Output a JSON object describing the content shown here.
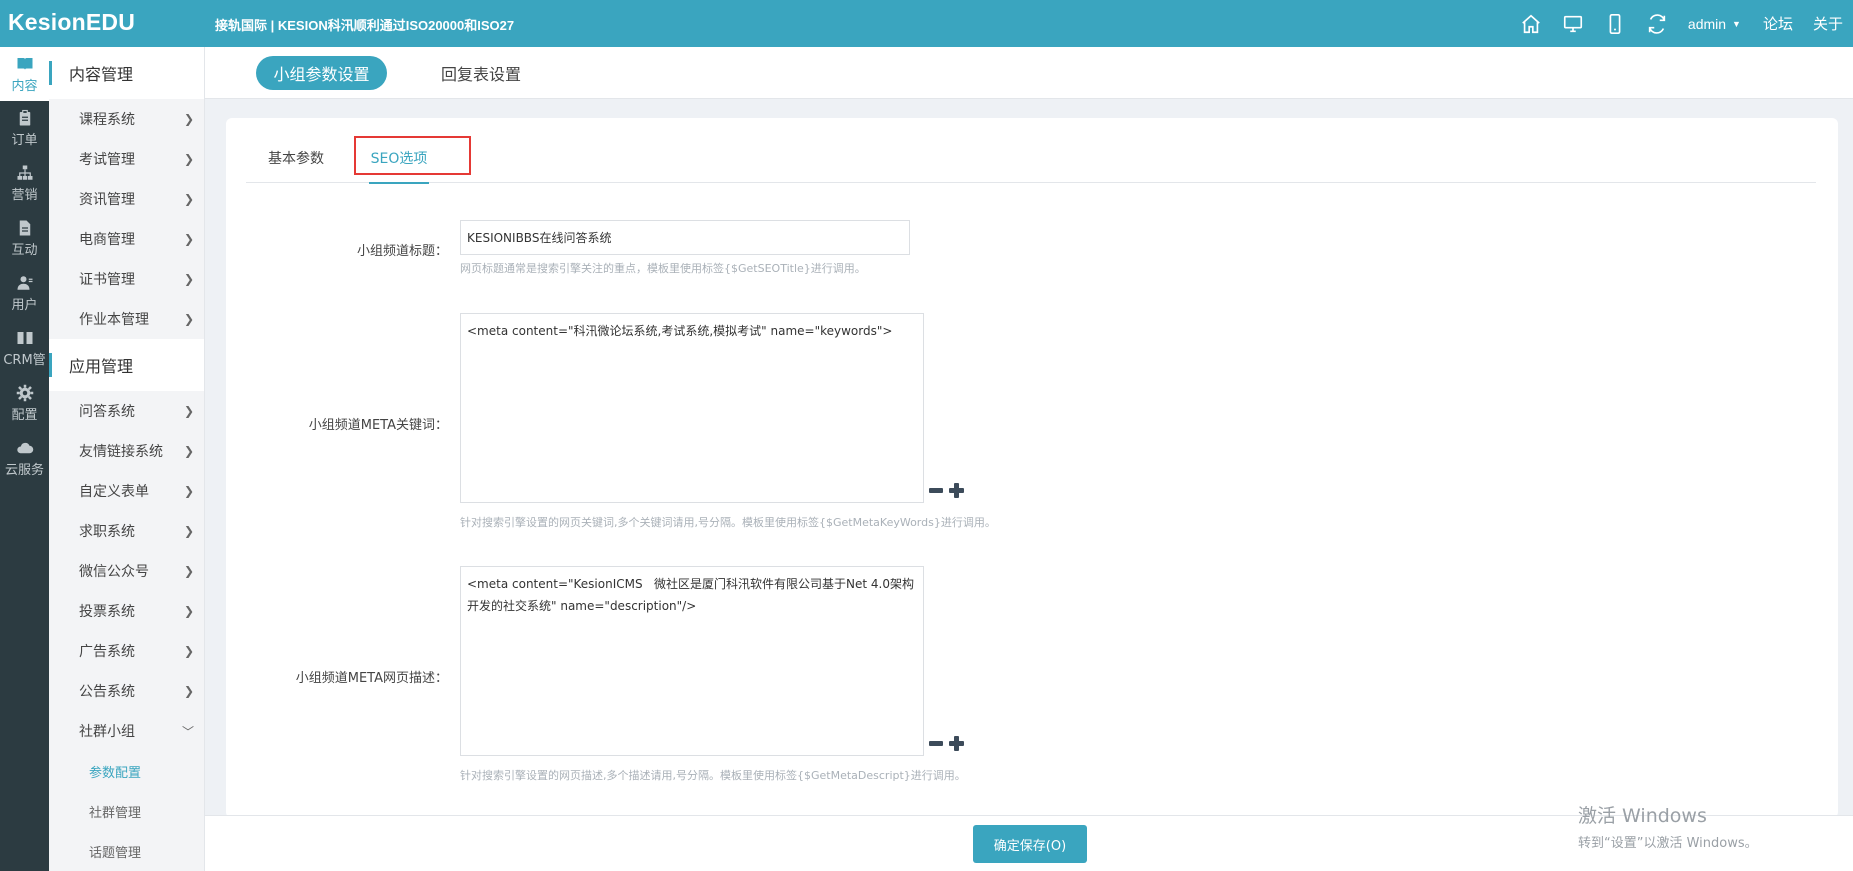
{
  "header": {
    "brand": "KesionEDU",
    "marquee": "接轨国际 | KESION科汛顺利通过ISO20000和ISO27",
    "admin": "admin",
    "links": [
      "论坛",
      "关于"
    ],
    "icons": [
      "home-icon",
      "desktop-icon",
      "mobile-icon",
      "refresh-icon"
    ]
  },
  "rail": {
    "items": [
      {
        "label": "内容",
        "icon": "book-icon",
        "active": true
      },
      {
        "label": "订单",
        "icon": "clipboard-icon"
      },
      {
        "label": "营销",
        "icon": "sitemap-icon"
      },
      {
        "label": "互动",
        "icon": "document-icon"
      },
      {
        "label": "用户",
        "icon": "user-icon"
      },
      {
        "label": "CRM管",
        "icon": "book-open-icon"
      },
      {
        "label": "配置",
        "icon": "gear-icon"
      },
      {
        "label": "云服务",
        "icon": "cloud-icon"
      }
    ]
  },
  "sidebar": {
    "group1": "内容管理",
    "group1_items": [
      "课程系统",
      "考试管理",
      "资讯管理",
      "电商管理",
      "证书管理",
      "作业本管理"
    ],
    "group2": "应用管理",
    "group2_items": [
      "问答系统",
      "友情链接系统",
      "自定义表单",
      "求职系统",
      "微信公众号",
      "投票系统",
      "广告系统",
      "公告系统"
    ],
    "expanded": "社群小组",
    "sub_items": [
      "参数配置",
      "社群管理",
      "话题管理"
    ]
  },
  "tabs": {
    "active": "小组参数设置",
    "other": "回复表设置"
  },
  "inner_tabs": {
    "basic": "基本参数",
    "seo": "SEO选项"
  },
  "form": {
    "title_label": "小组频道标题：",
    "title_value": "KESIONIBBS在线问答系统",
    "title_hint": "网页标题通常是搜索引擎关注的重点，模板里使用标签{$GetSEOTitle}进行调用。",
    "keywords_label": "小组频道META关键词：",
    "keywords_value": "<meta content=\"科汛微论坛系统,考试系统,模拟考试\" name=\"keywords\">",
    "keywords_hint": "针对搜索引擎设置的网页关键词,多个关键词请用,号分隔。模板里使用标签{$GetMetaKeyWords}进行调用。",
    "desc_label": "小组频道META网页描述：",
    "desc_value": "<meta content=\"KesionICMS   微社区是厦门科汛软件有限公司基于Net 4.0架构开发的社交系统\" name=\"description\"/>",
    "desc_hint": "针对搜索引擎设置的网页描述,多个描述请用,号分隔。模板里使用标签{$GetMetaDescript}进行调用。"
  },
  "save_label": "确定保存(O)",
  "watermark": {
    "line1": "激活 Windows",
    "line2": "转到“设置”以激活 Windows。"
  },
  "colors": {
    "primary": "#3aa5bf",
    "rail_bg": "#2c3b41",
    "highlight": "#e53935"
  }
}
